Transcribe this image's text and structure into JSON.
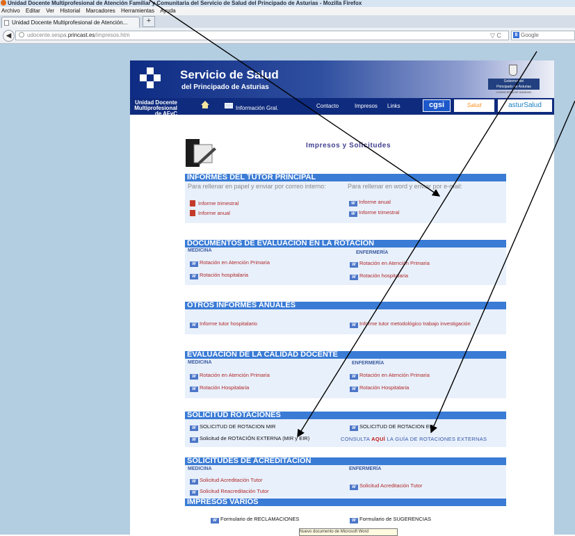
{
  "browser": {
    "title": "Unidad Docente Multiprofesional de Atención Familiar y Comunitaria del Servicio de Salud del Principado de Asturias - Mozilla Firefox",
    "menu": [
      "Archivo",
      "Editar",
      "Ver",
      "Historial",
      "Marcadores",
      "Herramientas",
      "Ayuda"
    ],
    "tab_label": "Unidad Docente Multiprofesional de Atención...",
    "new_tab": "+",
    "url_domain_prefix": "udocente.sespa.",
    "url_domain_bold": "princast.es",
    "url_path": "/impresos.htm",
    "search_engine": "Google",
    "back_glyph": "◀",
    "url_icons": "▽ C"
  },
  "site": {
    "title": "Servicio de Salud",
    "subtitle": "del Principado de Asturias",
    "gov_line1": "Gobierno del",
    "gov_line2": "Principado de Asturias",
    "gov_sub": "CONSEJERÍA DE SANIDAD",
    "unidad_line1": "Unidad Docente",
    "unidad_line2": "Multiprofesional de AFyC",
    "nav": {
      "info": "Información Gral.",
      "contacto": "Contacto",
      "impresos": "Impresos",
      "links": "Links"
    },
    "logo_cgsi": "cgsi",
    "logo_salud": "Salud",
    "logo_astur": "asturSalud"
  },
  "page": {
    "heading": "Impresos y Solicitudes"
  },
  "sections": {
    "informes": {
      "title": "INFORMES DEL TUTOR PRINCIPAL",
      "left_note": "Para rellenar en papel y enviar por correo interno:",
      "right_note": "Para rellenar en word y enviar por e-mail:",
      "left": [
        "Informe trimestral",
        "Informe anual"
      ],
      "right": [
        "Informe anual",
        "Informe trimestral"
      ]
    },
    "documentos": {
      "title": "DOCUMENTOS DE EVALUACIÓN EN LA ROTACIÓN",
      "left_head": "MEDICINA",
      "right_head": "ENFERMERÍA",
      "left": [
        "Rotación en Atención Primaria",
        "Rotación hospitalaria"
      ],
      "right": [
        "Rotación en Atención Primaria",
        "Rotación hospitalaria"
      ]
    },
    "otros": {
      "title": "OTROS INFORMES ANUALES",
      "left": [
        "Informe tutor hospitalario"
      ],
      "right": [
        "Informe tutor metodológico trabajo investigación"
      ]
    },
    "calidad": {
      "title": "EVALUACIÓN DE LA CALIDAD DOCENTE",
      "left_head": "MEDICINA",
      "right_head": "ENFERMERÍA",
      "left": [
        "Rotación en Atención Primaria",
        "Rotación Hospitalaria"
      ],
      "right": [
        "Rotación en Atención Primaria",
        "Rotación Hospitalaria"
      ]
    },
    "rotaciones": {
      "title": "SOLICITUD ROTACIONES",
      "left": [
        "SOLICITUD DE ROTACION MIR",
        "Solicitud de ROTACIÓN EXTERNA (MIR y EIR)"
      ],
      "right": [
        "SOLICITUD DE ROTACION EIR"
      ],
      "consulta_pre": "CONSULTA",
      "consulta_aqui": "AQUÍ",
      "consulta_post": "LA GUÍA  DE ROTACIONES EXTERNAS"
    },
    "acreditacion": {
      "title": "SOLICITUDES DE ACREDITACIÓN",
      "left_head": "MEDICINA",
      "right_head": "ENFERMERÍA",
      "left": [
        "Solicitud Acreditación Tutor",
        "Solicitud Reacreditación Tutor"
      ],
      "right": [
        "Solicitud Acreditación Tutor"
      ]
    },
    "varios": {
      "title": "IMPRESOS VARIOS",
      "left": [
        "Formulario de RECLAMACIONES"
      ],
      "right": [
        "Formulario de SUGERENCIAS"
      ]
    }
  },
  "tooltip": "Nuevo documento de Microsoft Word",
  "colors": {
    "section_header": "#3a7bd5",
    "background": "#b3cde1",
    "banner": "#0e2c83",
    "link": "#b02828"
  }
}
